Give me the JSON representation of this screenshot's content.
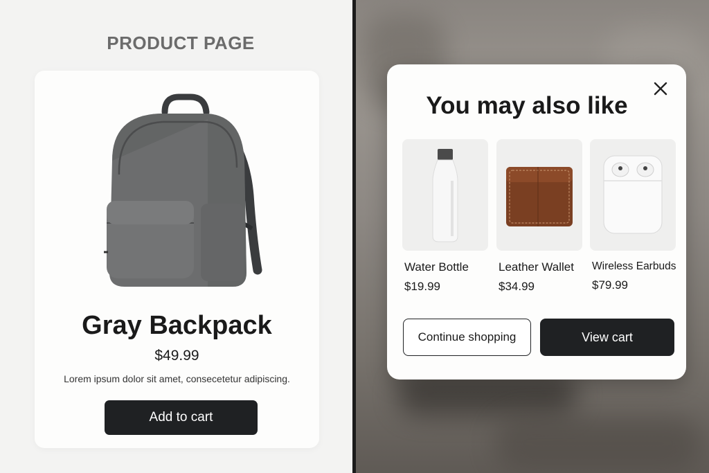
{
  "page": {
    "label": "PRODUCT PAGE"
  },
  "product": {
    "title": "Gray Backpack",
    "price": "$49.99",
    "description": "Lorem ipsum dolor sit amet, consecetetur adipiscing.",
    "add_to_cart_label": "Add to cart",
    "image_icon": "backpack-image"
  },
  "modal": {
    "title": "You may also like",
    "close_icon": "close-icon",
    "items": [
      {
        "name": "Water Bottle",
        "price": "$19.99",
        "image_icon": "water-bottle-image"
      },
      {
        "name": "Leather Wallet",
        "price": "$34.99",
        "image_icon": "wallet-image"
      },
      {
        "name": "Wireless Earbuds",
        "price": "$79.99",
        "image_icon": "earbuds-image"
      }
    ],
    "continue_label": "Continue shopping",
    "view_cart_label": "View cart"
  },
  "colors": {
    "primary_button": "#1f2123",
    "card_bg": "#fdfdfc",
    "page_bg": "#f3f3f2"
  }
}
